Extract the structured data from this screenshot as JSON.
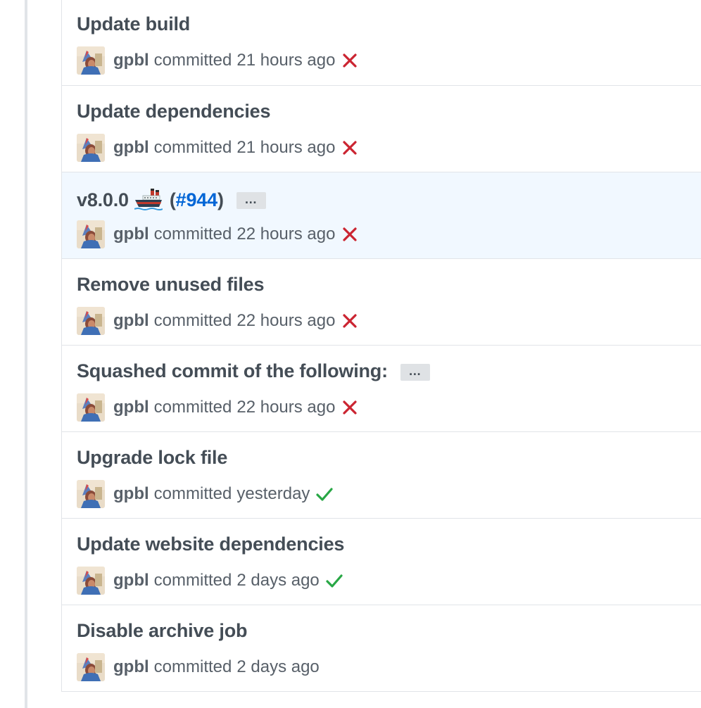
{
  "commits": [
    {
      "title": "Update build",
      "author": "gpbl",
      "verb": "committed",
      "time": "21 hours ago",
      "status": "failure"
    },
    {
      "title": "Update dependencies",
      "author": "gpbl",
      "verb": "committed",
      "time": "21 hours ago",
      "status": "failure"
    },
    {
      "title": "v8.0.0",
      "emoji": "ship-icon",
      "pr_open": "(",
      "pr": "#944",
      "pr_close": ")",
      "author": "gpbl",
      "verb": "committed",
      "time": "22 hours ago",
      "status": "failure",
      "has_ellipsis": true,
      "highlighted": true
    },
    {
      "title": "Remove unused files",
      "author": "gpbl",
      "verb": "committed",
      "time": "22 hours ago",
      "status": "failure"
    },
    {
      "title": "Squashed commit of the following:",
      "author": "gpbl",
      "verb": "committed",
      "time": "22 hours ago",
      "status": "failure",
      "has_ellipsis": true
    },
    {
      "title": "Upgrade lock file",
      "author": "gpbl",
      "verb": "committed",
      "time": "yesterday",
      "status": "success"
    },
    {
      "title": "Update website dependencies",
      "author": "gpbl",
      "verb": "committed",
      "time": "2 days ago",
      "status": "success"
    },
    {
      "title": "Disable archive job",
      "author": "gpbl",
      "verb": "committed",
      "time": "2 days ago",
      "status": "none"
    }
  ],
  "ellipsis_label": "…",
  "colors": {
    "failure": "#cb2431",
    "success": "#28a745",
    "link": "#0366d6",
    "highlight_bg": "#f1f8ff"
  }
}
